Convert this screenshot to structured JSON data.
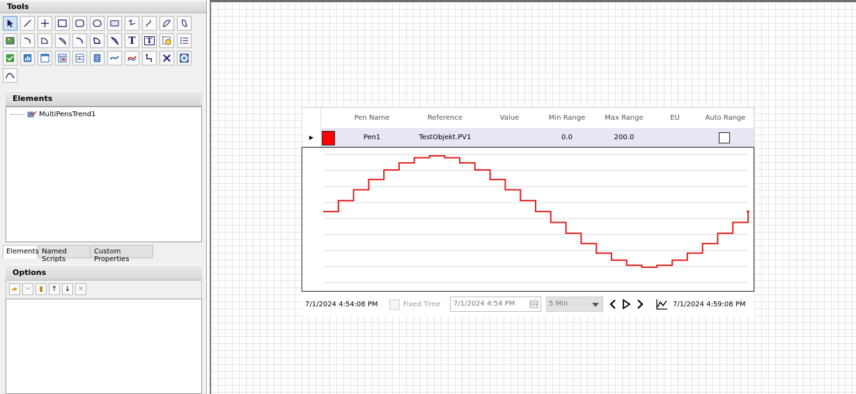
{
  "left_panel": {
    "tools_title": "Tools",
    "elements_title": "Elements",
    "tree_item": "MultiPensTrend1",
    "tabs": [
      "Elements",
      "Named Scripts",
      "Custom Properties"
    ],
    "options_title": "Options"
  },
  "tools": [
    "pointer-icon",
    "line-icon",
    "cross-icon",
    "rectangle-icon",
    "rounded-rect-icon",
    "ellipse-icon",
    "button-shape-icon",
    "polyline-icon",
    "curve-icon",
    "closed-curve-icon",
    "freeform-icon",
    "image-icon",
    "arc-icon",
    "chord-icon",
    "pie-icon",
    "arc-alt-icon",
    "chord-alt-icon",
    "pie-alt-icon",
    "text-icon",
    "textbox-icon",
    "alarm-icon",
    "list-icon",
    "checkbox-icon",
    "gauge-icon",
    "window-icon",
    "grid-icon",
    "table-icon",
    "report-icon",
    "trend-icon",
    "multi-trend-icon",
    "connector-icon",
    "delete-icon",
    "globe-icon",
    "chart-line-icon"
  ],
  "tool_text": {
    "text-icon": "T",
    "textbox-icon": "T"
  },
  "pen_table": {
    "headers": [
      "Pen Name",
      "Reference",
      "Value",
      "Min Range",
      "Max Range",
      "EU",
      "Auto Range"
    ],
    "row": {
      "pen_name": "Pen1",
      "reference": "TestObjekt.PV1",
      "value": "",
      "min_range": "0.0",
      "max_range": "200.0",
      "eu": "",
      "auto_range": false
    },
    "pen_color": "#ff0000"
  },
  "chart_data": {
    "type": "line",
    "series": [
      {
        "values": [
          111,
          128,
          145,
          161,
          176,
          187,
          195,
          198,
          195,
          187,
          176,
          161,
          145,
          128,
          111,
          94,
          77,
          61,
          46,
          35,
          27,
          24,
          27,
          35,
          46,
          61,
          77,
          94,
          111
        ]
      }
    ],
    "step": true,
    "ylim": [
      0,
      200
    ],
    "grid": "horizontal",
    "line_color": "#e02020"
  },
  "footer": {
    "start_time": "7/1/2024 4:54:08 PM",
    "fixed_time_label": "Fixed Time",
    "date_value": "7/1/2024 4:54 PM",
    "range_value": "5 Min",
    "end_time": "7/1/2024 4:59:08 PM"
  }
}
